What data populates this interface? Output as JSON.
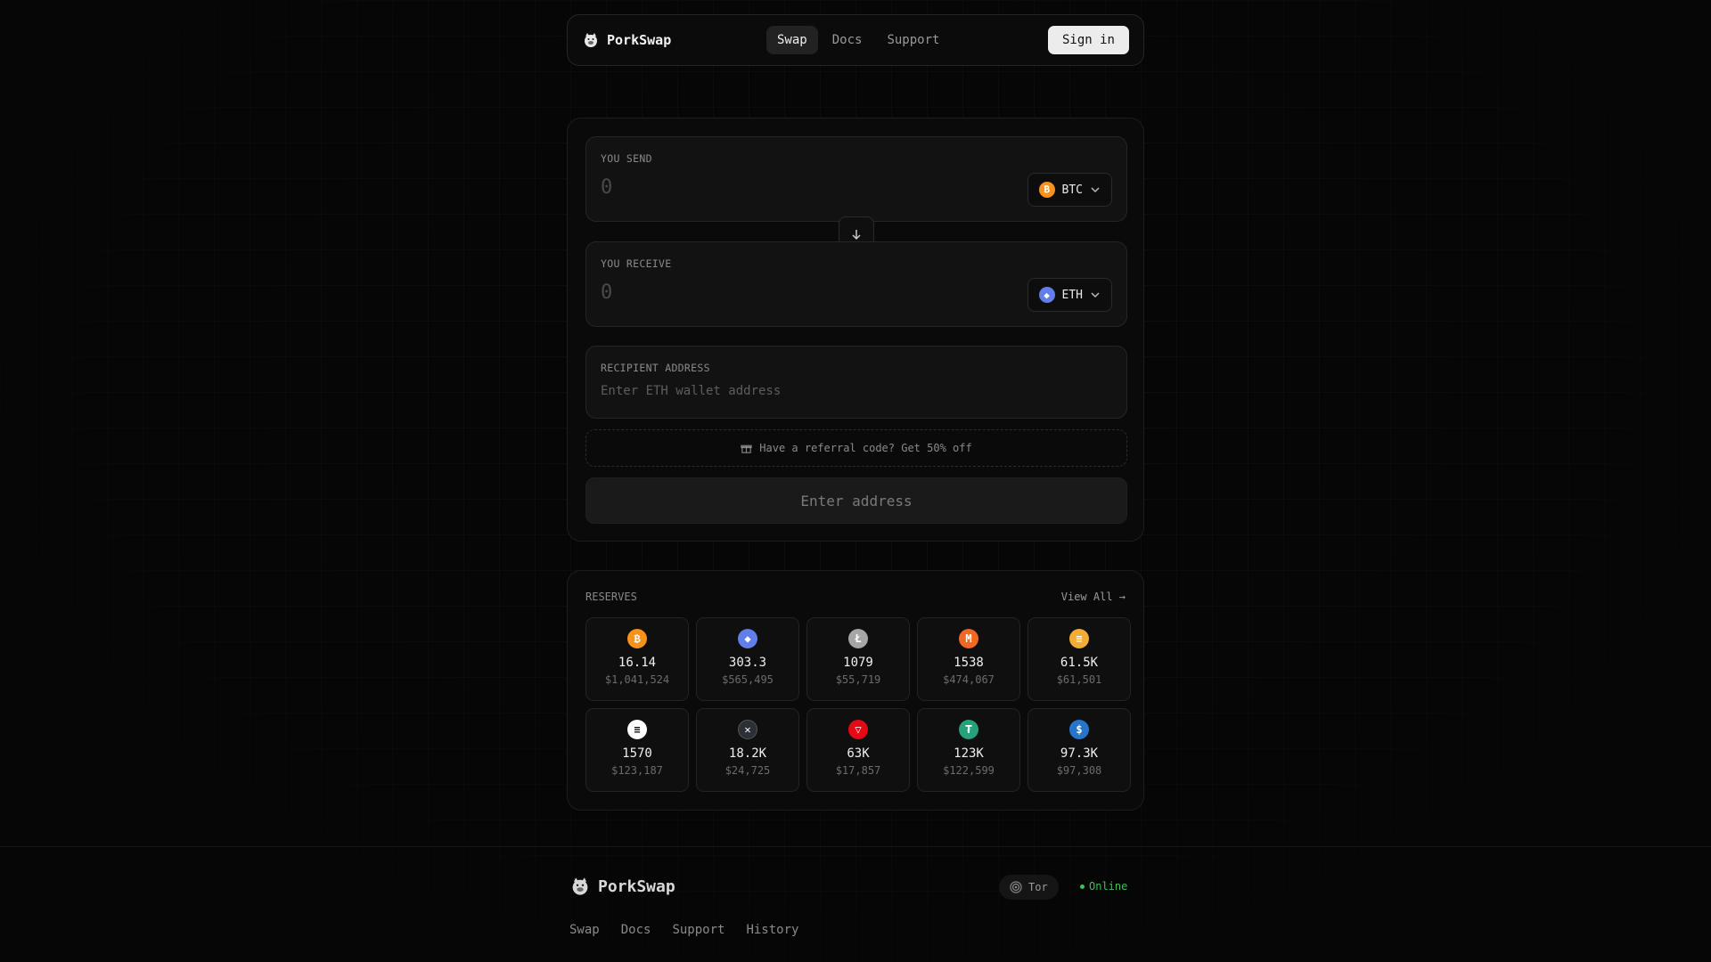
{
  "nav": {
    "brand": "PorkSwap",
    "links": [
      "Swap",
      "Docs",
      "Support"
    ],
    "signin": "Sign in"
  },
  "swap": {
    "send": {
      "label": "YOU SEND",
      "amount": "0",
      "token": "BTC",
      "token_icon": "bitcoin-icon",
      "token_color": "#f7931a"
    },
    "receive": {
      "label": "YOU RECEIVE",
      "amount": "0",
      "token": "ETH",
      "token_icon": "ethereum-icon",
      "token_color": "#627eea"
    },
    "recipient": {
      "label": "RECIPIENT ADDRESS",
      "placeholder": "Enter ETH wallet address"
    },
    "referral": "Have a referral code? Get 50% off",
    "cta": "Enter address"
  },
  "reserves": {
    "title": "RESERVES",
    "view_all": "View All →",
    "items": [
      {
        "icon": "bitcoin-icon",
        "color": "#f7931a",
        "amount": "16.14",
        "usd": "$1,041,524"
      },
      {
        "icon": "ethereum-icon",
        "color": "#627eea",
        "amount": "303.3",
        "usd": "$565,495"
      },
      {
        "icon": "litecoin-icon",
        "color": "#a6a6a6",
        "amount": "1079",
        "usd": "$55,719"
      },
      {
        "icon": "monero-icon",
        "color": "#f26822",
        "amount": "1538",
        "usd": "$474,067"
      },
      {
        "icon": "dai-icon",
        "color": "#f5ac37",
        "amount": "61.5K",
        "usd": "$61,501"
      },
      {
        "icon": "solana-icon",
        "color": "#ffffff",
        "amount": "1570",
        "usd": "$123,187"
      },
      {
        "icon": "xrp-icon",
        "color": "#2b2f36",
        "amount": "18.2K",
        "usd": "$24,725"
      },
      {
        "icon": "tron-icon",
        "color": "#e50915",
        "amount": "63K",
        "usd": "$17,857"
      },
      {
        "icon": "tether-icon",
        "color": "#26a17b",
        "amount": "123K",
        "usd": "$122,599"
      },
      {
        "icon": "usdc-icon",
        "color": "#2775ca",
        "amount": "97.3K",
        "usd": "$97,308"
      }
    ]
  },
  "footer": {
    "brand": "PorkSwap",
    "tor": "Tor",
    "status": "Online",
    "links": [
      "Swap",
      "Docs",
      "Support",
      "History"
    ]
  }
}
